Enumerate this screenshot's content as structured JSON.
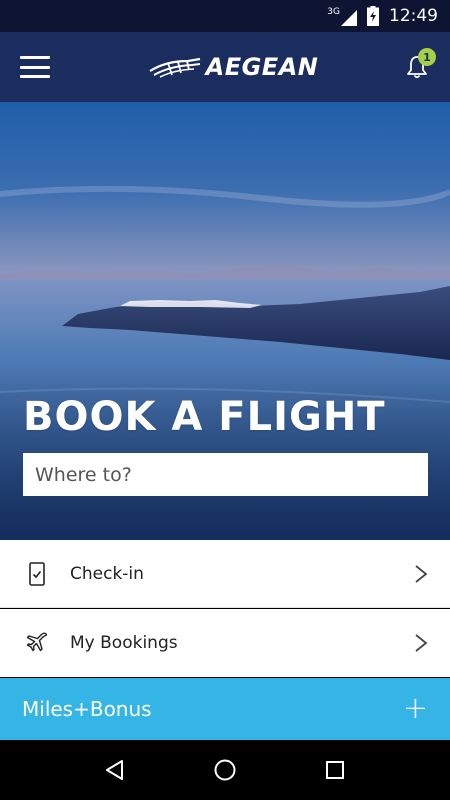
{
  "status_bar": {
    "network": "3G",
    "time": "12:49"
  },
  "app_bar": {
    "brand": "AEGEAN",
    "notification_count": "1"
  },
  "hero": {
    "title": "BOOK A FLIGHT",
    "search_placeholder": "Where to?"
  },
  "menu": {
    "items": [
      {
        "label": "Check-in",
        "icon": "phone-checkin-icon"
      },
      {
        "label": "My Bookings",
        "icon": "plane-icon"
      }
    ]
  },
  "miles": {
    "label": "Miles+Bonus",
    "action": "+"
  },
  "colors": {
    "status_bar": "#0d1533",
    "app_bar": "#1b2c5e",
    "badge": "#a5cf47",
    "miles_bar": "#35b5e5"
  }
}
